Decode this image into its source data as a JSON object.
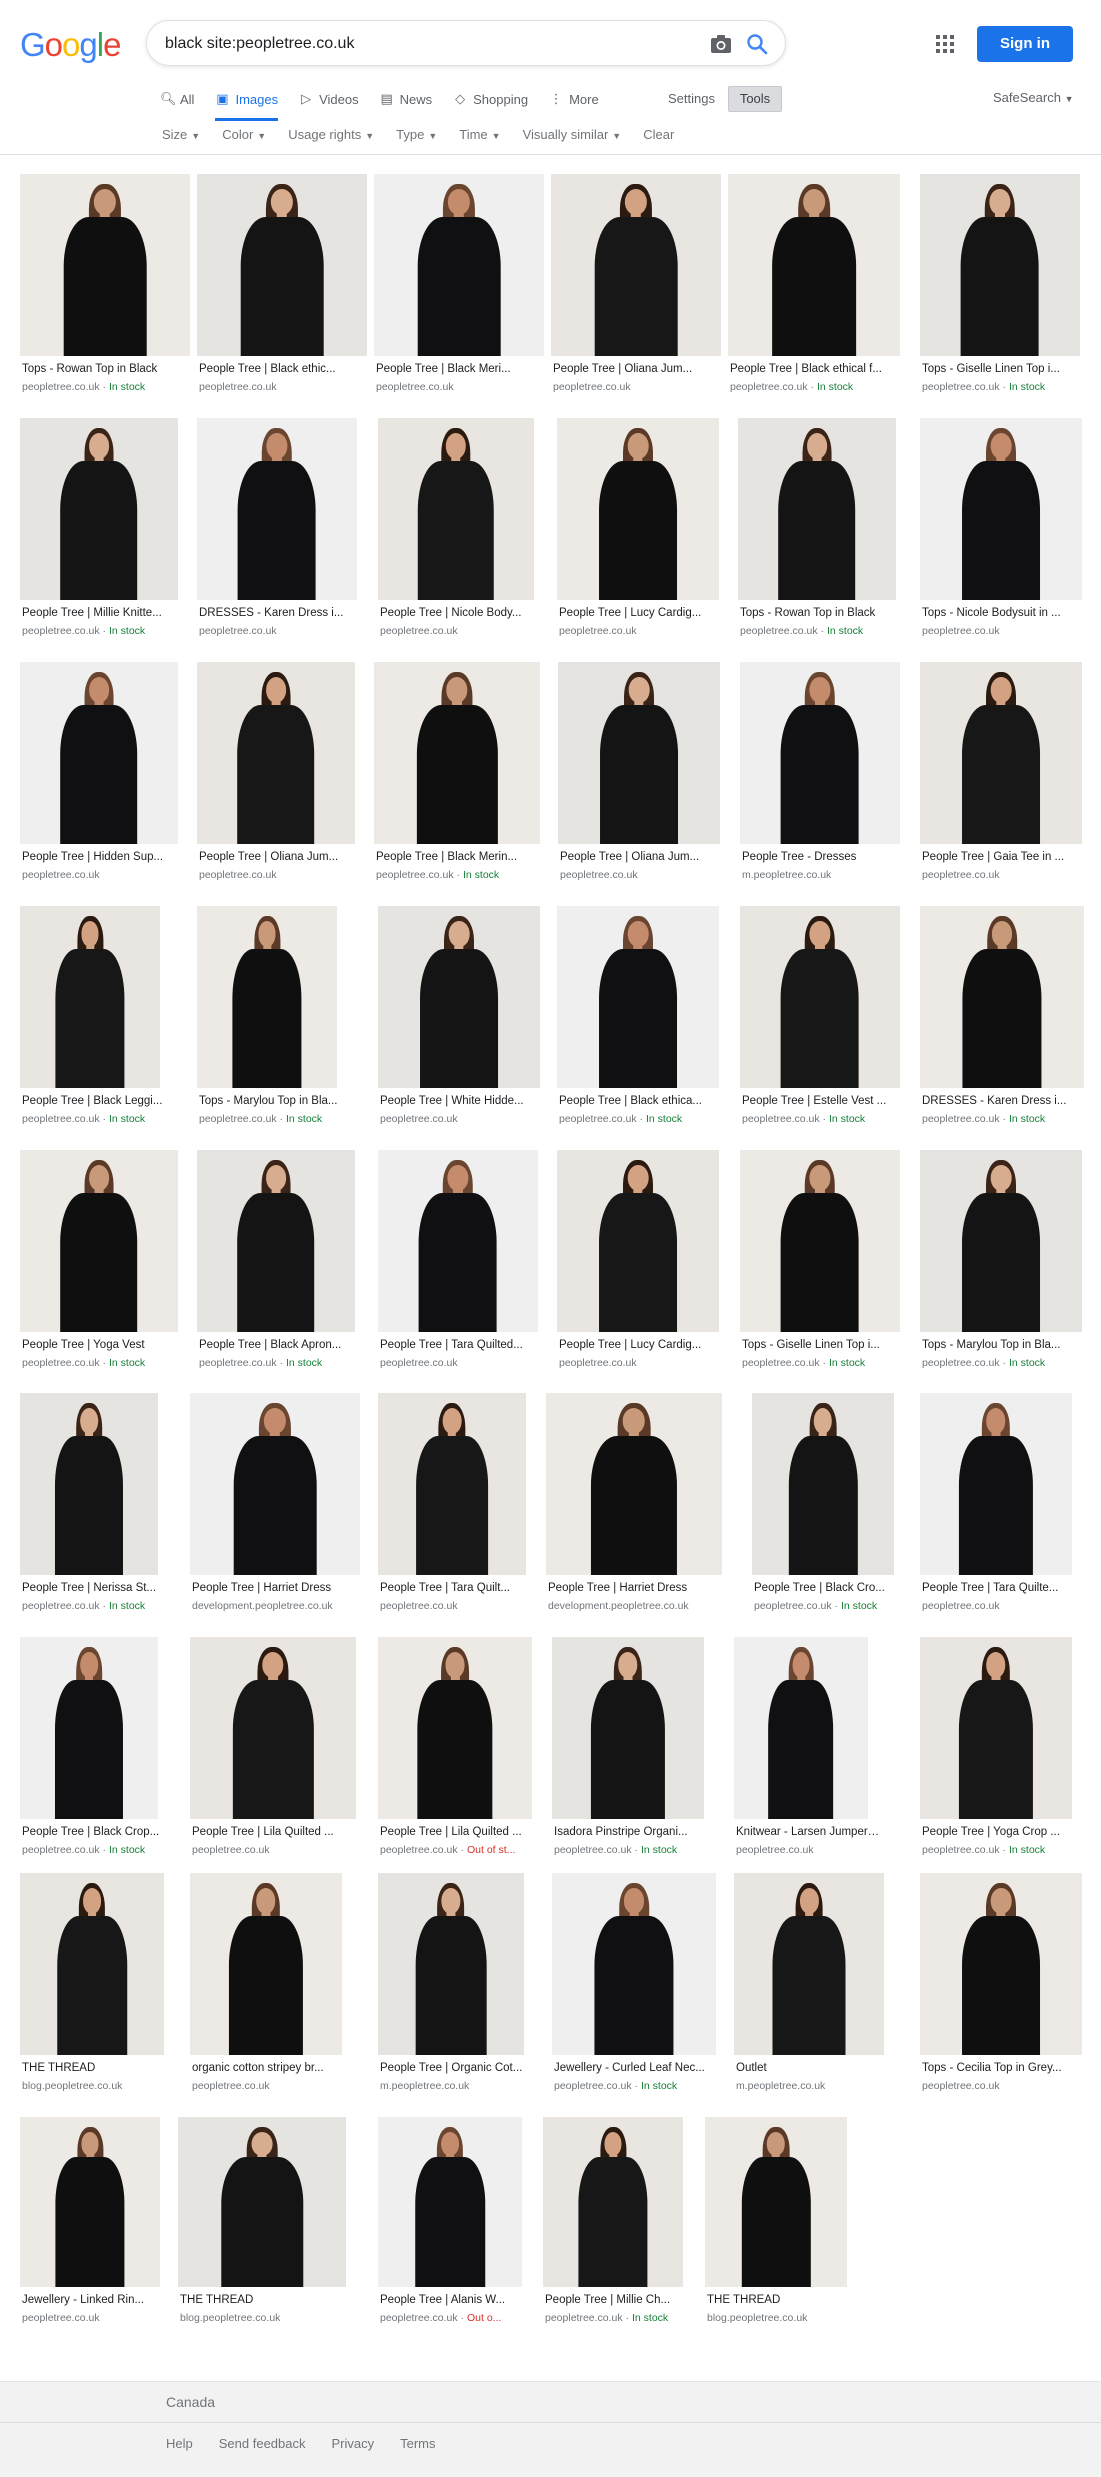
{
  "logo": {
    "text": [
      "G",
      "o",
      "o",
      "g",
      "l",
      "e"
    ],
    "colors": [
      "#4285f4",
      "#ea4335",
      "#fbbc05",
      "#4285f4",
      "#34a853",
      "#ea4335"
    ]
  },
  "search": {
    "query": "black site:peopletree.co.uk"
  },
  "header": {
    "signin_label": "Sign in"
  },
  "tabs": [
    {
      "label": "All",
      "icon": "search-icon",
      "active": false
    },
    {
      "label": "Images",
      "icon": "image-icon",
      "active": true
    },
    {
      "label": "Videos",
      "icon": "video-icon",
      "active": false
    },
    {
      "label": "News",
      "icon": "news-icon",
      "active": false
    },
    {
      "label": "Shopping",
      "icon": "tag-icon",
      "active": false
    },
    {
      "label": "More",
      "icon": "more-vert-icon",
      "active": false
    }
  ],
  "settings_label": "Settings",
  "tools_label": "Tools",
  "safesearch_label": "SafeSearch",
  "filters": [
    "Size",
    "Color",
    "Usage rights",
    "Type",
    "Time",
    "Visually similar",
    "Clear"
  ],
  "results": [
    [
      {
        "title": "Tops - Rowan Top in Black",
        "source": "peopletree.co.uk",
        "status": "In stock"
      },
      {
        "title": "People Tree | Black ethic...",
        "source": "peopletree.co.uk",
        "status": ""
      },
      {
        "title": "People Tree | Black Meri...",
        "source": "peopletree.co.uk",
        "status": ""
      },
      {
        "title": "People Tree | Oliana Jum...",
        "source": "peopletree.co.uk",
        "status": ""
      },
      {
        "title": "People Tree | Black ethical f...",
        "source": "peopletree.co.uk",
        "status": "In stock"
      },
      {
        "title": "Tops - Giselle Linen Top i...",
        "source": "peopletree.co.uk",
        "status": "In stock"
      }
    ],
    [
      {
        "title": "People Tree | Millie Knitte...",
        "source": "peopletree.co.uk",
        "status": "In stock"
      },
      {
        "title": "DRESSES - Karen Dress i...",
        "source": "peopletree.co.uk",
        "status": ""
      },
      {
        "title": "People Tree | Nicole Body...",
        "source": "peopletree.co.uk",
        "status": ""
      },
      {
        "title": "People Tree | Lucy Cardig...",
        "source": "peopletree.co.uk",
        "status": ""
      },
      {
        "title": "Tops - Rowan Top in Black",
        "source": "peopletree.co.uk",
        "status": "In stock"
      },
      {
        "title": "Tops - Nicole Bodysuit in ...",
        "source": "peopletree.co.uk",
        "status": ""
      }
    ],
    [
      {
        "title": "People Tree | Hidden Sup...",
        "source": "peopletree.co.uk",
        "status": ""
      },
      {
        "title": "People Tree | Oliana Jum...",
        "source": "peopletree.co.uk",
        "status": ""
      },
      {
        "title": "People Tree | Black Merin...",
        "source": "peopletree.co.uk",
        "status": "In stock"
      },
      {
        "title": "People Tree | Oliana Jum...",
        "source": "peopletree.co.uk",
        "status": ""
      },
      {
        "title": "People Tree - Dresses",
        "source": "m.peopletree.co.uk",
        "status": ""
      },
      {
        "title": "People Tree | Gaia Tee in ...",
        "source": "peopletree.co.uk",
        "status": ""
      }
    ],
    [
      {
        "title": "People Tree | Black Leggi...",
        "source": "peopletree.co.uk",
        "status": "In stock"
      },
      {
        "title": "Tops - Marylou Top in Bla...",
        "source": "peopletree.co.uk",
        "status": "In stock"
      },
      {
        "title": "People Tree | White Hidde...",
        "source": "peopletree.co.uk",
        "status": ""
      },
      {
        "title": "People Tree | Black ethica...",
        "source": "peopletree.co.uk",
        "status": "In stock"
      },
      {
        "title": "People Tree | Estelle Vest ...",
        "source": "peopletree.co.uk",
        "status": "In stock"
      },
      {
        "title": "DRESSES - Karen Dress i...",
        "source": "peopletree.co.uk",
        "status": "In stock"
      }
    ],
    [
      {
        "title": "People Tree | Yoga Vest",
        "source": "peopletree.co.uk",
        "status": "In stock"
      },
      {
        "title": "People Tree | Black Apron...",
        "source": "peopletree.co.uk",
        "status": "In stock"
      },
      {
        "title": "People Tree | Tara Quilted...",
        "source": "peopletree.co.uk",
        "status": ""
      },
      {
        "title": "People Tree | Lucy Cardig...",
        "source": "peopletree.co.uk",
        "status": ""
      },
      {
        "title": "Tops - Giselle Linen Top i...",
        "source": "peopletree.co.uk",
        "status": "In stock"
      },
      {
        "title": "Tops - Marylou Top in Bla...",
        "source": "peopletree.co.uk",
        "status": "In stock"
      }
    ],
    [
      {
        "title": "People Tree | Nerissa St...",
        "source": "peopletree.co.uk",
        "status": "In stock"
      },
      {
        "title": "People Tree | Harriet Dress",
        "source": "development.peopletree.co.uk",
        "status": ""
      },
      {
        "title": "People Tree | Tara Quilt...",
        "source": "peopletree.co.uk",
        "status": ""
      },
      {
        "title": "People Tree | Harriet Dress",
        "source": "development.peopletree.co.uk",
        "status": ""
      },
      {
        "title": "People Tree | Black Cro...",
        "source": "peopletree.co.uk",
        "status": "In stock"
      },
      {
        "title": "People Tree | Tara Quilte...",
        "source": "peopletree.co.uk",
        "status": ""
      }
    ],
    [
      {
        "title": "People Tree | Black Crop...",
        "source": "peopletree.co.uk",
        "status": "In stock"
      },
      {
        "title": "People Tree | Lila Quilted ...",
        "source": "peopletree.co.uk",
        "status": ""
      },
      {
        "title": "People Tree | Lila Quilted ...",
        "source": "peopletree.co.uk",
        "status": "Out of st..."
      },
      {
        "title": "Isadora Pinstripe Organi...",
        "source": "peopletree.co.uk",
        "status": "In stock"
      },
      {
        "title": "Knitwear - Larsen Jumper ...",
        "source": "peopletree.co.uk",
        "status": ""
      },
      {
        "title": "People Tree | Yoga Crop ...",
        "source": "peopletree.co.uk",
        "status": "In stock"
      }
    ],
    [
      {
        "title": "THE THREAD",
        "source": "blog.peopletree.co.uk",
        "status": ""
      },
      {
        "title": "organic cotton stripey br...",
        "source": "peopletree.co.uk",
        "status": ""
      },
      {
        "title": "People Tree | Organic Cot...",
        "source": "m.peopletree.co.uk",
        "status": ""
      },
      {
        "title": "Jewellery - Curled Leaf Nec...",
        "source": "peopletree.co.uk",
        "status": "In stock"
      },
      {
        "title": "Outlet",
        "source": "m.peopletree.co.uk",
        "status": ""
      },
      {
        "title": "Tops - Cecilia Top in Grey...",
        "source": "peopletree.co.uk",
        "status": ""
      }
    ],
    [
      {
        "title": "Jewellery - Linked Rin...",
        "source": "peopletree.co.uk",
        "status": ""
      },
      {
        "title": "THE THREAD",
        "source": "blog.peopletree.co.uk",
        "status": ""
      },
      {
        "title": "People Tree | Alanis W...",
        "source": "peopletree.co.uk",
        "status": "Out o..."
      },
      {
        "title": "People Tree | Millie Ch...",
        "source": "peopletree.co.uk",
        "status": "In stock"
      },
      {
        "title": "THE THREAD",
        "source": "blog.peopletree.co.uk",
        "status": ""
      }
    ]
  ],
  "footer": {
    "country": "Canada",
    "links": [
      "Help",
      "Send feedback",
      "Privacy",
      "Terms"
    ]
  }
}
